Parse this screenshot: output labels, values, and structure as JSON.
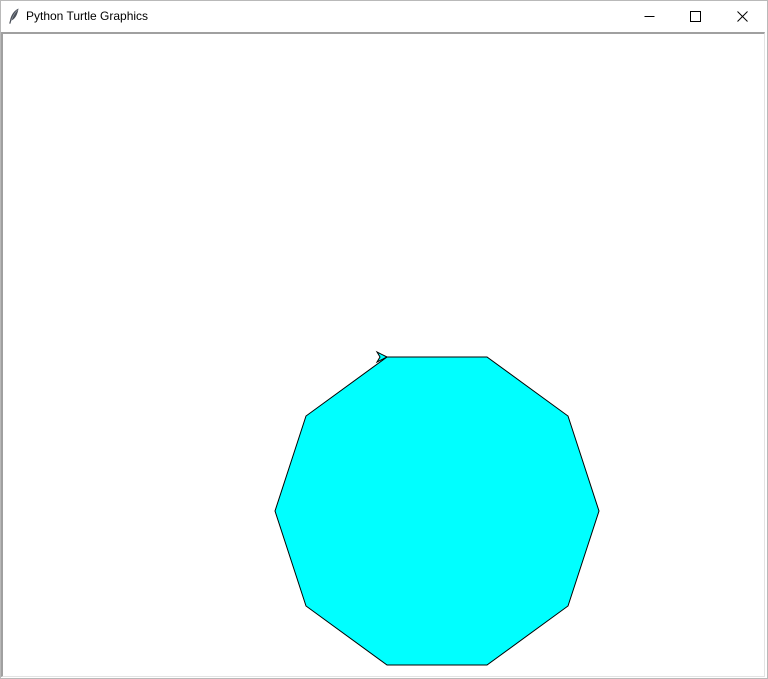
{
  "window": {
    "title": "Python Turtle Graphics",
    "app_icon": "feather-icon",
    "controls": {
      "minimize_icon": "minimize-icon",
      "maximize_icon": "maximize-icon",
      "close_icon": "close-icon"
    }
  },
  "canvas": {
    "background": "#ffffff",
    "shape": {
      "type": "decagon",
      "sides": 10,
      "fill_color": "#00ffff",
      "outline_color": "#000000"
    },
    "turtle": {
      "icon": "turtle-arrow-icon",
      "color": "#000000"
    }
  }
}
